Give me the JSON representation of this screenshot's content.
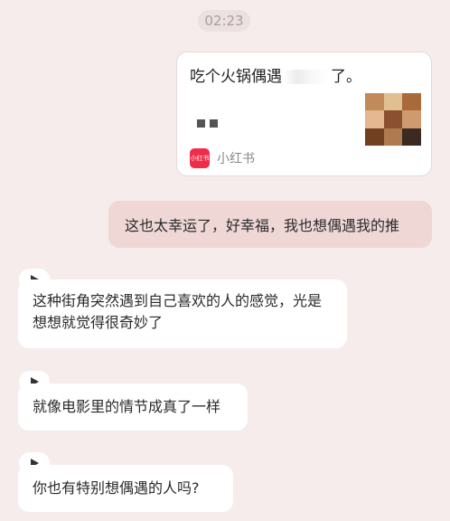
{
  "timestamp": "02:23",
  "shared_card": {
    "title_start": "吃个火锅偶遇",
    "title_end": "了。",
    "source_label": "小红书",
    "source_logo_text": "小红书",
    "thumbnail_colors": [
      "#c08a5a",
      "#e0c090",
      "#a86a3a",
      "#e4b890",
      "#8a5030",
      "#d09a70",
      "#704020",
      "#b07a50",
      "#3a2a20"
    ]
  },
  "messages": [
    {
      "role": "user",
      "text": "这也太幸运了，好幸福，我也想偶遇我的推"
    },
    {
      "role": "assistant",
      "text": "这种街角突然遇到自己喜欢的人的感觉，光是想想就觉得很奇妙了"
    },
    {
      "role": "assistant",
      "text": "就像电影里的情节成真了一样"
    },
    {
      "role": "assistant",
      "text": "你也有特别想偶遇的人吗?"
    }
  ]
}
